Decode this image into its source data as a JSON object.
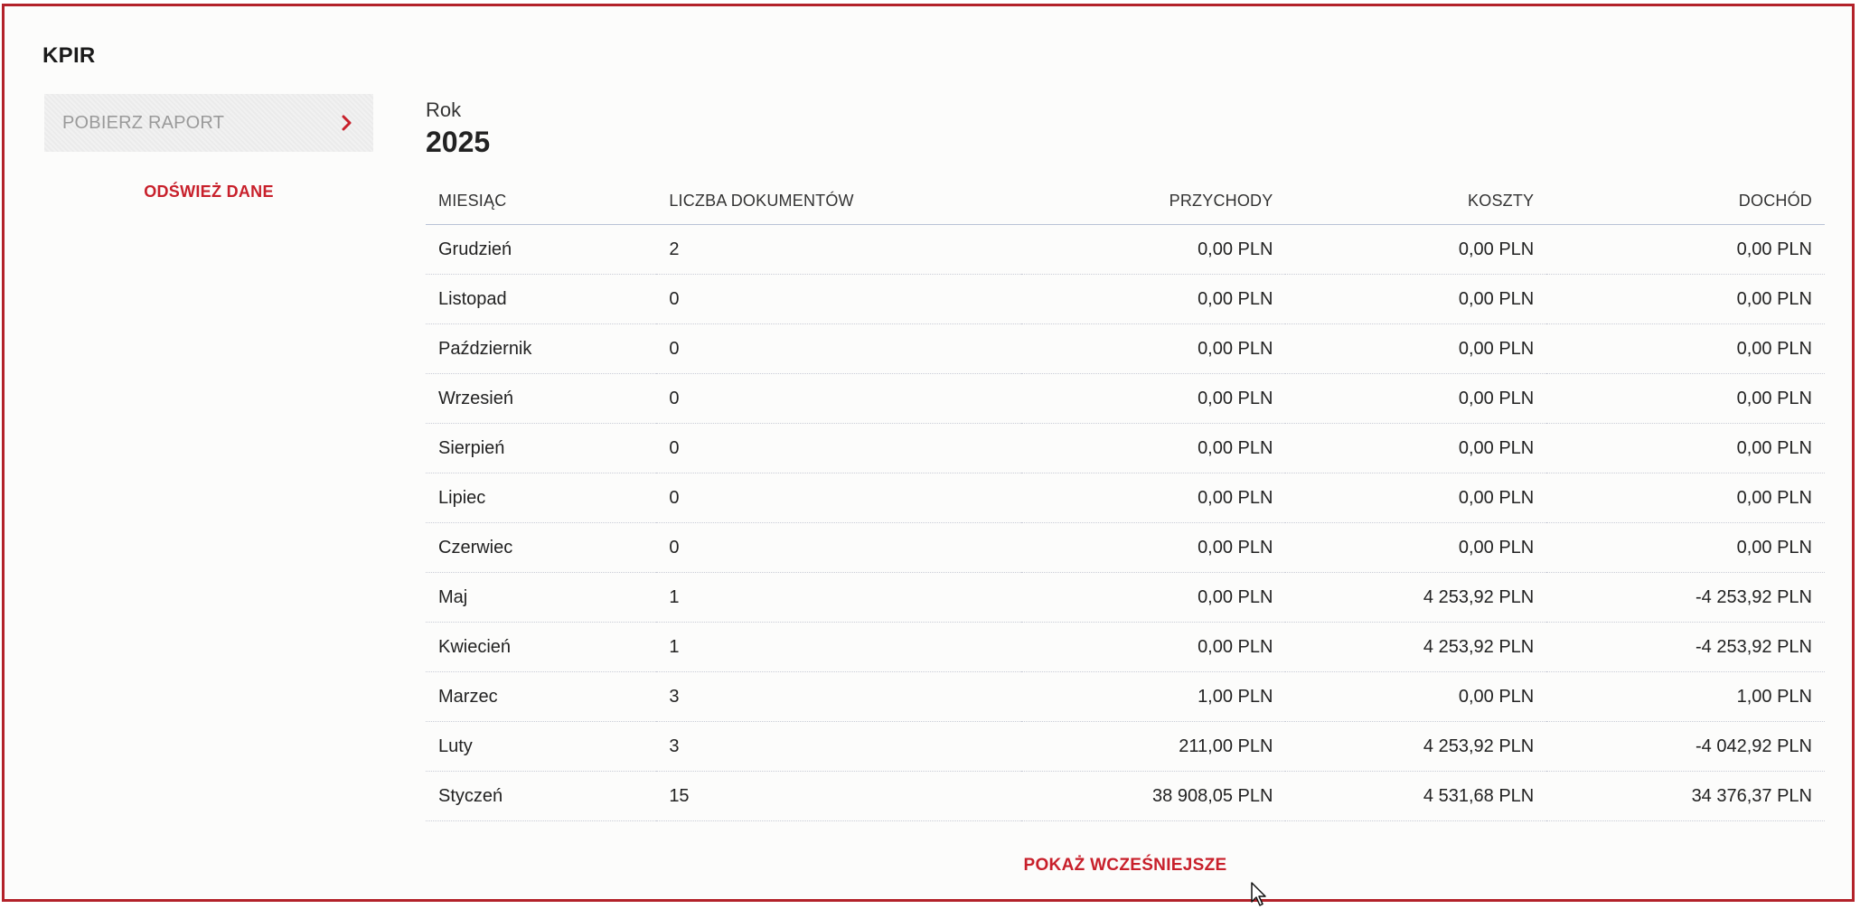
{
  "app": {
    "title": "KPIR"
  },
  "sidebar": {
    "report_button_label": "POBIERZ RAPORT",
    "refresh_label": "ODŚWIEŻ DANE"
  },
  "main": {
    "year_label": "Rok",
    "year_value": "2025",
    "show_more_label": "POKAŻ WCZEŚNIEJSZE"
  },
  "table": {
    "headers": {
      "month": "MIESIĄC",
      "documents": "LICZBA DOKUMENTÓW",
      "revenue": "PRZYCHODY",
      "costs": "KOSZTY",
      "income": "DOCHÓD"
    },
    "rows": [
      {
        "month": "Grudzień",
        "documents": "2",
        "revenue": "0,00 PLN",
        "costs": "0,00 PLN",
        "income": "0,00 PLN"
      },
      {
        "month": "Listopad",
        "documents": "0",
        "revenue": "0,00 PLN",
        "costs": "0,00 PLN",
        "income": "0,00 PLN"
      },
      {
        "month": "Październik",
        "documents": "0",
        "revenue": "0,00 PLN",
        "costs": "0,00 PLN",
        "income": "0,00 PLN"
      },
      {
        "month": "Wrzesień",
        "documents": "0",
        "revenue": "0,00 PLN",
        "costs": "0,00 PLN",
        "income": "0,00 PLN"
      },
      {
        "month": "Sierpień",
        "documents": "0",
        "revenue": "0,00 PLN",
        "costs": "0,00 PLN",
        "income": "0,00 PLN"
      },
      {
        "month": "Lipiec",
        "documents": "0",
        "revenue": "0,00 PLN",
        "costs": "0,00 PLN",
        "income": "0,00 PLN"
      },
      {
        "month": "Czerwiec",
        "documents": "0",
        "revenue": "0,00 PLN",
        "costs": "0,00 PLN",
        "income": "0,00 PLN"
      },
      {
        "month": "Maj",
        "documents": "1",
        "revenue": "0,00 PLN",
        "costs": "4 253,92 PLN",
        "income": "-4 253,92 PLN"
      },
      {
        "month": "Kwiecień",
        "documents": "1",
        "revenue": "0,00 PLN",
        "costs": "4 253,92 PLN",
        "income": "-4 253,92 PLN"
      },
      {
        "month": "Marzec",
        "documents": "3",
        "revenue": "1,00 PLN",
        "costs": "0,00 PLN",
        "income": "1,00 PLN"
      },
      {
        "month": "Luty",
        "documents": "3",
        "revenue": "211,00 PLN",
        "costs": "4 253,92 PLN",
        "income": "-4 042,92 PLN"
      },
      {
        "month": "Styczeń",
        "documents": "15",
        "revenue": "38 908,05 PLN",
        "costs": "4 531,68 PLN",
        "income": "34 376,37 PLN"
      }
    ]
  },
  "colors": {
    "accent": "#c8202b",
    "frame_border": "#b3222a"
  },
  "icons": {
    "report_chevron": "chevron-right-icon",
    "cursor": "mouse-pointer-icon"
  }
}
